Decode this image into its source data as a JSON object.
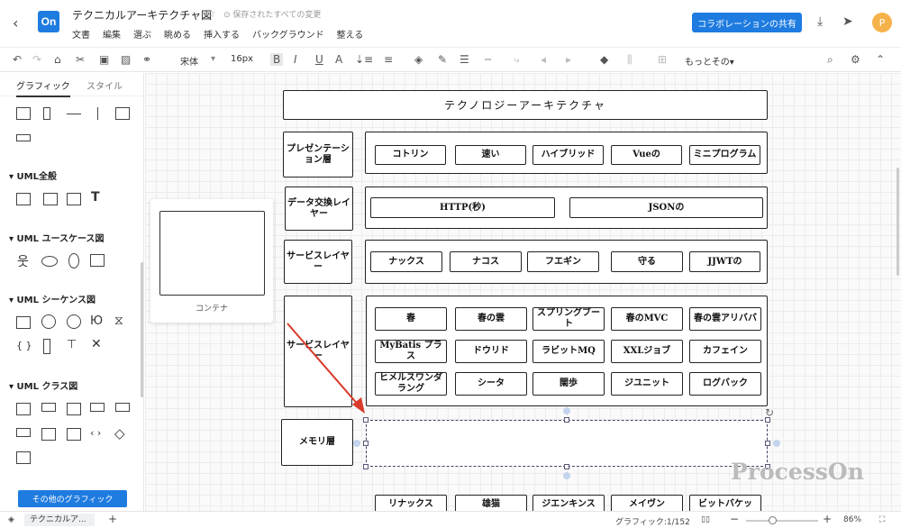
{
  "header": {
    "back_icon": "chevron-left-icon",
    "logo": "On",
    "title": "テクニカルアーキテクチャ図",
    "save_status": "保存されたすべての変更",
    "menu": [
      "文書",
      "編集",
      "選ぶ",
      "眺める",
      "挿入する",
      "バックグラウンド",
      "整える"
    ],
    "collab_button": "コラボレーションの共有",
    "avatar": "P"
  },
  "toolbar": {
    "font": "宋体",
    "font_size": "16px",
    "more": "もっとその"
  },
  "sidebar": {
    "tabs": [
      "グラフィック",
      "スタイル"
    ],
    "sections": [
      "UML全般",
      "UML ユースケース図",
      "UML シーケンス図",
      "UML クラス図"
    ],
    "more_button": "その他のグラフィック"
  },
  "canvas": {
    "container_label": "コンテナ",
    "diagram_title": "テクノロジーアーキテクチャ",
    "layers": [
      "プレゼンテーション層",
      "データ交換レイヤー",
      "サービスレイヤー",
      "サービスレイヤー",
      "メモリ層"
    ],
    "row1": [
      "コトリン",
      "速い",
      "ハイブリッド",
      "Vueの",
      "ミニプログラム"
    ],
    "row2": [
      "HTTP(秒)",
      "JSONの"
    ],
    "row3": [
      "ナックス",
      "ナコス",
      "フエギン",
      "守る",
      "JJWTの"
    ],
    "row4a": [
      "春",
      "春の雲",
      "スプリングブート",
      "春のMVC",
      "春の雲アリババ"
    ],
    "row4b": [
      "MyBatis プラス",
      "ドウリド",
      "ラビットMQ",
      "XXLジョブ",
      "カフェイン"
    ],
    "row4c": [
      "ヒメルスワンダラング",
      "シータ",
      "闊歩",
      "ジユニット",
      "ログバック"
    ],
    "row5": [
      "リナックス",
      "雄猫",
      "ジエンキンス",
      "メイヴン",
      "ビットバケッ"
    ],
    "watermark": "ProcessOn"
  },
  "statusbar": {
    "page_tab": "テクニカルア...",
    "add": "+",
    "graphics_count": "グラフィック:1/152",
    "zoom": "86%"
  }
}
